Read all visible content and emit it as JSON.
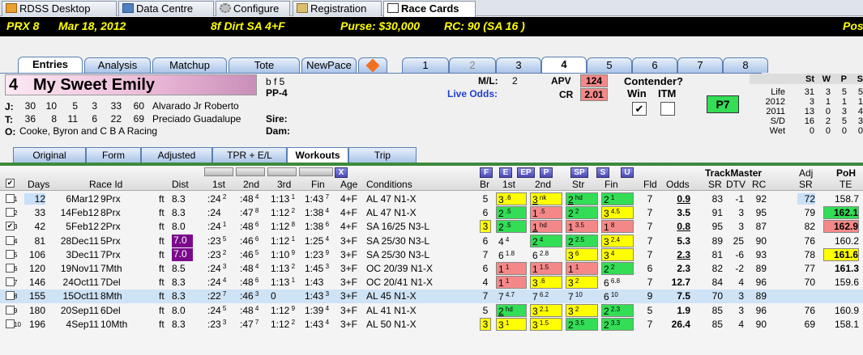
{
  "top_tabs": [
    {
      "label": "RDSS Desktop",
      "icon": "desktop-icon"
    },
    {
      "label": "Data Centre",
      "icon": "data-icon"
    },
    {
      "label": "Configure",
      "icon": "gear-icon"
    },
    {
      "label": "Registration",
      "icon": "key-icon"
    },
    {
      "label": "Race Cards",
      "icon": "card-icon"
    }
  ],
  "race_header": {
    "prx": "PRX  8",
    "date": "Mar 18, 2012",
    "surface": "8f  Dirt   SA  4+F",
    "purse": "Purse: $30,000",
    "rc": "RC: 90  (SA 16 )",
    "pos": "Pos"
  },
  "entry_tabs": [
    "Entries",
    "Analysis",
    "Matchup",
    "Tote",
    "NewPace"
  ],
  "number_tabs": [
    "1",
    "2",
    "3",
    "4",
    "5",
    "6",
    "7",
    "8"
  ],
  "horse": {
    "number": "4",
    "name": "My Sweet Emily",
    "info1": "b f 5",
    "info2": "PP-4",
    "sire_label": "Sire:",
    "dam_label": "Dam:",
    "jockey": {
      "label": "J:",
      "stats": [
        "30",
        "10",
        "5",
        "3",
        "33",
        "60"
      ],
      "name": "Alvarado Jr Roberto"
    },
    "trainer": {
      "label": "T:",
      "stats": [
        "36",
        "8",
        "11",
        "6",
        "22",
        "69"
      ],
      "name": "Preciado Guadalupe"
    },
    "owner": {
      "label": "O:",
      "name": "Cooke, Byron and C B A Racing"
    },
    "ml_label": "M/L:",
    "ml_value": "2",
    "live_odds_label": "Live Odds:",
    "apv_label": "APV",
    "apv_value": "124",
    "cr_label": "CR",
    "cr_value": "2.01",
    "contender_label": "Contender?",
    "win_label": "Win",
    "itm_label": "ITM",
    "win_check": "✔",
    "p7": "P7"
  },
  "record": {
    "headers": [
      "St",
      "W",
      "P",
      "S"
    ],
    "rows": [
      {
        "label": "Life",
        "v": [
          "31",
          "3",
          "5",
          "5"
        ]
      },
      {
        "label": "2012",
        "v": [
          "3",
          "1",
          "1",
          "1"
        ]
      },
      {
        "label": "2011",
        "v": [
          "13",
          "0",
          "3",
          "4"
        ]
      },
      {
        "label": "S/D",
        "v": [
          "16",
          "2",
          "5",
          "3"
        ]
      },
      {
        "label": "Wet",
        "v": [
          "0",
          "0",
          "0",
          "0"
        ]
      }
    ]
  },
  "sub_tabs": [
    "Original",
    "Form",
    "Adjusted",
    "TPR + E/L",
    "Workouts",
    "Trip"
  ],
  "pace_buttons": [
    "F",
    "E",
    "EP",
    "P"
  ],
  "finish_buttons": [
    "SP",
    "S",
    "U"
  ],
  "x_button": "X",
  "columns": {
    "days": "Days",
    "raceid": "Race Id",
    "dist": "Dist",
    "c1": "1st",
    "c2": "2nd",
    "c3": "3rd",
    "fin": "Fin",
    "age": "Age",
    "cond": "Conditions",
    "br": "Br",
    "p1": "1st",
    "p2": "2nd",
    "str": "Str",
    "pfin": "Fin",
    "fld": "Fld",
    "odds": "Odds",
    "trackmaster": "TrackMaster",
    "sr": "SR",
    "dtv": "DTV",
    "rc": "RC",
    "adj": "Adj",
    "adjsr": "SR",
    "poh": "PoH",
    "te": "TE"
  },
  "rows": [
    {
      "rn": "1",
      "chk": "",
      "days": "12",
      "date": "6Mar12",
      "race": "9Prx",
      "sf": "ft",
      "dist": "8.3",
      "f1": ":24",
      "f1s": "2",
      "f2": ":48",
      "f2s": "4",
      "f3": "1:13",
      "f3s": "1",
      "fin": "1:43",
      "fins": "7",
      "age": "4+F",
      "cond": "AL 47 N1-X",
      "br": "5",
      "p1": "3",
      "p1s": ".6",
      "p1c": "y",
      "p2": "3",
      "p2s": "nk",
      "p2c": "y",
      "p2u": true,
      "st": "2",
      "sts": "hd",
      "stc": "g",
      "stu": true,
      "fp": "2",
      "fps": "1",
      "fpc": "g",
      "fld": "7",
      "odds": "0.9",
      "ou": true,
      "sr": "83",
      "dtv": "-1",
      "rc": "92",
      "adj": "72",
      "te": "158.7",
      "tec": ""
    },
    {
      "rn": "2",
      "chk": "",
      "days": "33",
      "date": "14Feb12",
      "race": "8Prx",
      "sf": "ft",
      "dist": "8.3",
      "f1": ":24",
      "f1s": "",
      "f2": ":47",
      "f2s": "8",
      "f3": "1:12",
      "f3s": "2",
      "fin": "1:38",
      "fins": "4",
      "age": "4+F",
      "cond": "AL 47 N1-X",
      "br": "6",
      "p1": "2",
      "p1s": ".5",
      "p1c": "g",
      "p2": "1",
      "p2s": ".5",
      "p2c": "p",
      "p2u": false,
      "st": "2",
      "sts": "2",
      "stc": "g",
      "stu": false,
      "fp": "3",
      "fps": "4.5",
      "fpc": "y",
      "fld": "7",
      "odds": "3.5",
      "ou": false,
      "sr": "91",
      "dtv": "3",
      "rc": "95",
      "adj": "79",
      "te": "162.1",
      "tec": "g"
    },
    {
      "rn": "3",
      "chk": "✔",
      "days": "42",
      "date": "5Feb12",
      "race": "2Prx",
      "sf": "ft",
      "dist": "8.0",
      "f1": ":24",
      "f1s": "1",
      "f2": ":48",
      "f2s": "6",
      "f3": "1:12",
      "f3s": "8",
      "fin": "1:38",
      "fins": "6",
      "age": "4+F",
      "cond": "SA 16/25 N3-L",
      "br": "3",
      "p1": "2",
      "p1s": ".5",
      "p1c": "g",
      "p2": "1",
      "p2s": "hd",
      "p2c": "p",
      "p2u": true,
      "st": "1",
      "sts": "3.5",
      "stc": "p",
      "stu": false,
      "fp": "1",
      "fps": "8",
      "fpc": "p",
      "fld": "7",
      "odds": "0.8",
      "ou": true,
      "sr": "95",
      "dtv": "3",
      "rc": "87",
      "adj": "82",
      "te": "162.9",
      "tec": "p"
    },
    {
      "rn": "4",
      "chk": "",
      "days": "81",
      "date": "28Dec11",
      "race": "5Prx",
      "sf": "ft",
      "dist": "7.0",
      "f1": ":23",
      "f1s": "5",
      "f2": ":46",
      "f2s": "6",
      "f3": "1:12",
      "f3s": "1",
      "fin": "1:25",
      "fins": "4",
      "age": "3+F",
      "cond": "SA 25/30 N3-L",
      "br": "6",
      "p1": "4",
      "p1s": "4",
      "p1c": "",
      "p2": "2",
      "p2s": "4",
      "p2c": "g",
      "p2u": false,
      "st": "2",
      "sts": "2.5",
      "stc": "g",
      "stu": false,
      "fp": "3",
      "fps": "2.4",
      "fpc": "y",
      "fld": "7",
      "odds": "5.3",
      "ou": false,
      "sr": "89",
      "dtv": "25",
      "rc": "90",
      "adj": "76",
      "te": "160.2",
      "tec": ""
    },
    {
      "rn": "5",
      "chk": "",
      "days": "106",
      "date": "3Dec11",
      "race": "7Prx",
      "sf": "ft",
      "dist": "7.0",
      "f1": ":23",
      "f1s": "2",
      "f2": ":46",
      "f2s": "5",
      "f3": "1:10",
      "f3s": "9",
      "fin": "1:23",
      "fins": "9",
      "age": "3+F",
      "cond": "SA 25/30 N3-L",
      "br": "7",
      "p1": "6",
      "p1s": "1.8",
      "p1c": "",
      "p2": "6",
      "p2s": "2.8",
      "p2c": "",
      "p2u": false,
      "st": "3",
      "sts": "6",
      "stc": "y",
      "stu": false,
      "fp": "3",
      "fps": "4",
      "fpc": "y",
      "fld": "7",
      "odds": "2.3",
      "ou": true,
      "sr": "81",
      "dtv": "-6",
      "rc": "93",
      "adj": "78",
      "te": "161.6",
      "tec": "y"
    },
    {
      "rn": "6",
      "chk": "",
      "days": "120",
      "date": "19Nov11",
      "race": "7Mth",
      "sf": "ft",
      "dist": "8.5",
      "f1": ":24",
      "f1s": "3",
      "f2": ":48",
      "f2s": "4",
      "f3": "1:13",
      "f3s": "2",
      "fin": "1:45",
      "fins": "3",
      "age": "3+F",
      "cond": "OC 20/39 N1-X",
      "br": "6",
      "p1": "1",
      "p1s": "1",
      "p1c": "p",
      "p2": "1",
      "p2s": "1.5",
      "p2c": "p",
      "p2u": false,
      "st": "1",
      "sts": "1",
      "stc": "p",
      "stu": false,
      "fp": "2",
      "fps": "2",
      "fpc": "g",
      "fld": "6",
      "odds": "2.3",
      "ou": false,
      "sr": "82",
      "dtv": "-2",
      "rc": "89",
      "adj": "77",
      "te": "161.3",
      "tec": "b"
    },
    {
      "rn": "7",
      "chk": "",
      "days": "146",
      "date": "24Oct11",
      "race": "7Del",
      "sf": "ft",
      "dist": "8.3",
      "f1": ":24",
      "f1s": "4",
      "f2": ":48",
      "f2s": "6",
      "f3": "1:13",
      "f3s": "1",
      "fin": "1:43",
      "fins": "",
      "age": "3+F",
      "cond": "OC 20/41 N1-X",
      "br": "4",
      "p1": "1",
      "p1s": "1",
      "p1c": "p",
      "p2": "3",
      "p2s": ".6",
      "p2c": "y",
      "p2u": false,
      "st": "3",
      "sts": "2",
      "stc": "y",
      "stu": false,
      "fp": "6",
      "fps": "6.8",
      "fpc": "",
      "fld": "7",
      "odds": "12.7",
      "ou": false,
      "sr": "84",
      "dtv": "4",
      "rc": "96",
      "adj": "70",
      "te": "159.6",
      "tec": ""
    },
    {
      "rn": "8",
      "chk": "",
      "days": "155",
      "date": "15Oct11",
      "race": "8Mth",
      "sf": "ft",
      "dist": "8.3",
      "f1": ":22",
      "f1s": "7",
      "f2": ":46",
      "f2s": "3",
      "f3": "0",
      "f3s": "",
      "fin": "1:43",
      "fins": "3",
      "age": "3+F",
      "cond": "AL 45 N1-X",
      "br": "7",
      "p1": "7",
      "p1s": "4.7",
      "p1c": "",
      "p2": "7",
      "p2s": "6.2",
      "p2c": "",
      "p2u": false,
      "st": "7",
      "sts": "10",
      "stc": "",
      "stu": false,
      "fp": "6",
      "fps": "10",
      "fpc": "",
      "fld": "9",
      "odds": "7.5",
      "ou": false,
      "sr": "70",
      "dtv": "3",
      "rc": "89",
      "adj": "",
      "te": "",
      "tec": "",
      "sel": true
    },
    {
      "rn": "9",
      "chk": "",
      "days": "180",
      "date": "20Sep11",
      "race": "6Del",
      "sf": "ft",
      "dist": "8.0",
      "f1": ":24",
      "f1s": "5",
      "f2": ":48",
      "f2s": "4",
      "f3": "1:12",
      "f3s": "9",
      "fin": "1:39",
      "fins": "4",
      "age": "3+F",
      "cond": "AL 41 N1-X",
      "br": "5",
      "p1": "2",
      "p1s": "hd",
      "p1c": "g",
      "p1u": true,
      "p2": "3",
      "p2s": "2.1",
      "p2c": "y",
      "p2u": false,
      "st": "3",
      "sts": "2",
      "stc": "y",
      "stu": false,
      "fp": "2",
      "fps": "2.3",
      "fpc": "g",
      "fld": "5",
      "odds": "1.9",
      "ou": false,
      "sr": "85",
      "dtv": "3",
      "rc": "96",
      "adj": "76",
      "te": "160.9",
      "tec": ""
    },
    {
      "rn": "10",
      "chk": "",
      "days": "196",
      "date": "4Sep11",
      "race": "10Mth",
      "sf": "ft",
      "dist": "8.3",
      "f1": ":23",
      "f1s": "3",
      "f2": ":47",
      "f2s": "7",
      "f3": "1:12",
      "f3s": "2",
      "fin": "1:43",
      "fins": "4",
      "age": "3+F",
      "cond": "AL 50 N1-X",
      "br": "3",
      "p1": "3",
      "p1s": "1",
      "p1c": "y",
      "p2": "3",
      "p2s": "1.5",
      "p2c": "y",
      "p2u": false,
      "st": "2",
      "sts": "3.5",
      "stc": "g",
      "stu": false,
      "fp": "2",
      "fps": "3.3",
      "fpc": "g",
      "fld": "7",
      "odds": "26.4",
      "ou": false,
      "sr": "85",
      "dtv": "4",
      "rc": "90",
      "adj": "69",
      "te": "158.1",
      "tec": ""
    }
  ],
  "colors": {
    "yellow": "#ffff00",
    "green": "#33dd55",
    "pink": "#f48888",
    "purple": "#7a0a8a",
    "header_bg": "#000000",
    "header_fg": "#ffff00"
  }
}
